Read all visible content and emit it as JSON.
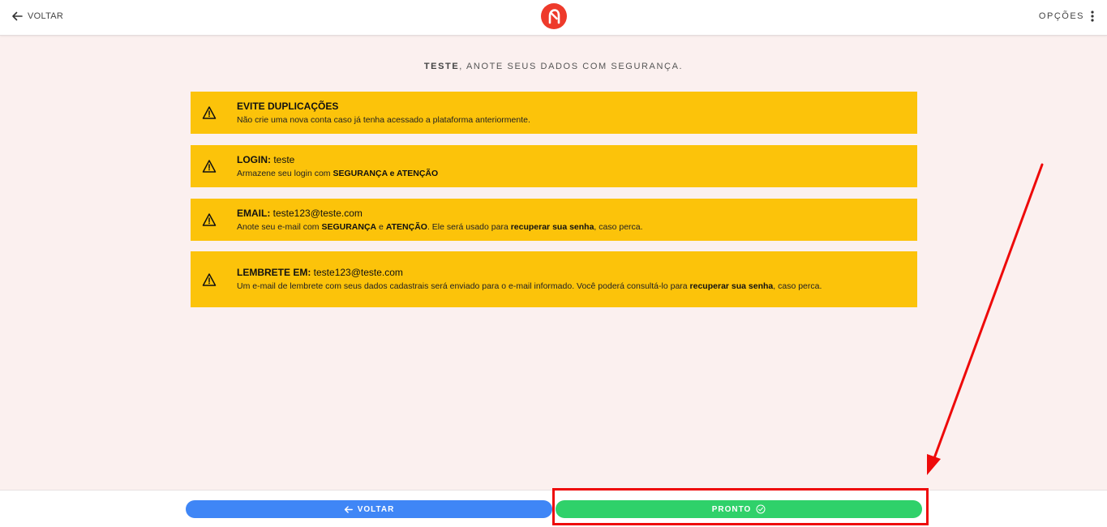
{
  "header": {
    "back_label": "VOLTAR",
    "options_label": "OPÇÕES",
    "logo_icon": "brand-logo-icon"
  },
  "heading": {
    "user": "TESTE",
    "text": ", ANOTE SEUS DADOS COM SEGURANÇA."
  },
  "cards": [
    {
      "title_strong": "EVITE DUPLICAÇÕES",
      "title_value": "",
      "desc": [
        {
          "t": "Não crie uma nova conta caso já tenha acessado a plataforma anteriormente.",
          "b": false
        }
      ]
    },
    {
      "title_strong": "LOGIN:",
      "title_value": " teste",
      "desc": [
        {
          "t": "Armazene seu login com ",
          "b": false
        },
        {
          "t": "SEGURANÇA e ATENÇÃO",
          "b": true
        }
      ]
    },
    {
      "title_strong": "EMAIL:",
      "title_value": " teste123@teste.com",
      "desc": [
        {
          "t": "Anote seu e-mail com ",
          "b": false
        },
        {
          "t": "SEGURANÇA",
          "b": true
        },
        {
          "t": " e ",
          "b": false
        },
        {
          "t": "ATENÇÃO",
          "b": true
        },
        {
          "t": ". Ele será usado para ",
          "b": false
        },
        {
          "t": "recuperar sua senha",
          "b": true
        },
        {
          "t": ", caso perca.",
          "b": false
        }
      ]
    },
    {
      "title_strong": "LEMBRETE EM:",
      "title_value": " teste123@teste.com",
      "desc": [
        {
          "t": "Um e-mail de lembrete com seus dados cadastrais será enviado para o e-mail informado. Você poderá consultá-lo para ",
          "b": false
        },
        {
          "t": "recuperar sua senha",
          "b": true
        },
        {
          "t": ", caso perca.",
          "b": false
        }
      ]
    }
  ],
  "footer": {
    "back_button": "VOLTAR",
    "done_button": "PRONTO"
  },
  "colors": {
    "page_bg": "#fbf0ef",
    "card_bg": "#fcc30a",
    "brand": "#ee3a2b",
    "primary_blue": "#3f86f6",
    "success_green": "#2fd16a",
    "annotation_red": "#ee0a0a"
  }
}
